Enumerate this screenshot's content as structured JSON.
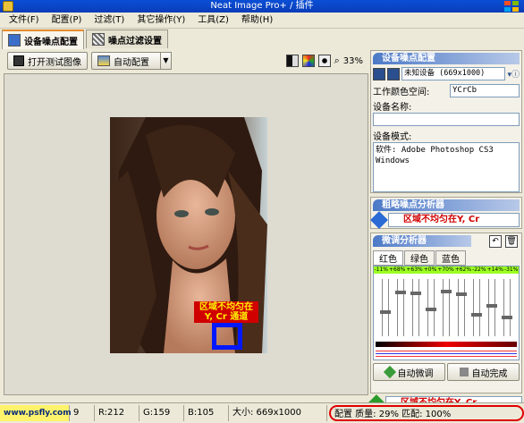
{
  "window": {
    "title": "Neat Image Pro+ / 插件"
  },
  "menu": [
    "文件(F)",
    "配置(P)",
    "过滤(T)",
    "其它操作(Y)",
    "工具(Z)",
    "帮助(H)"
  ],
  "tabs": [
    {
      "label": "设备噪点配置",
      "active": true
    },
    {
      "label": "噪点过滤设置",
      "active": false
    }
  ],
  "toolbar": {
    "open_label": "打开测试图像",
    "auto_label": "自动配置",
    "zoom": "33%"
  },
  "image": {
    "warning_line1": "区域不均匀在",
    "warning_line2": "Y, Cr 通道"
  },
  "device_profile": {
    "title": "设备噪点配置",
    "device_select": "未知设备 (669x1000)",
    "color_space_label": "工作颜色空间:",
    "color_space_value": "YCrCb",
    "device_name_label": "设备名称:",
    "device_name_value": "",
    "device_mode_label": "设备模式:",
    "device_mode_value": "软件: Adobe Photoshop CS3 Windows"
  },
  "coarse_analyzer": {
    "title": "粗略噪点分析器",
    "message": "区域不均匀在Y, Cr"
  },
  "fine_tune": {
    "title": "微调分析器",
    "tabs": [
      "红色",
      "绿色",
      "蓝色"
    ],
    "active_tab": "红色",
    "percentages": [
      "-11%",
      "+68%",
      "+63%",
      "+0%",
      "+70%",
      "+62%",
      "-22%",
      "+14%",
      "-31%"
    ],
    "auto_fine_label": "自动微调",
    "auto_done_label": "自动完成",
    "message": "区域不均匀在Y, Cr"
  },
  "status": {
    "watermark": "www.psfly.com",
    "cell0": "9",
    "r": "R:212",
    "g": "G:159",
    "b": "B:105",
    "size": "大小: 669x1000",
    "quality": "配置 质量: 29% 匹配: 100%"
  },
  "colors": {
    "accent": "#e68b2c",
    "warning_red": "#d10000",
    "selection_blue": "#0018ff"
  }
}
